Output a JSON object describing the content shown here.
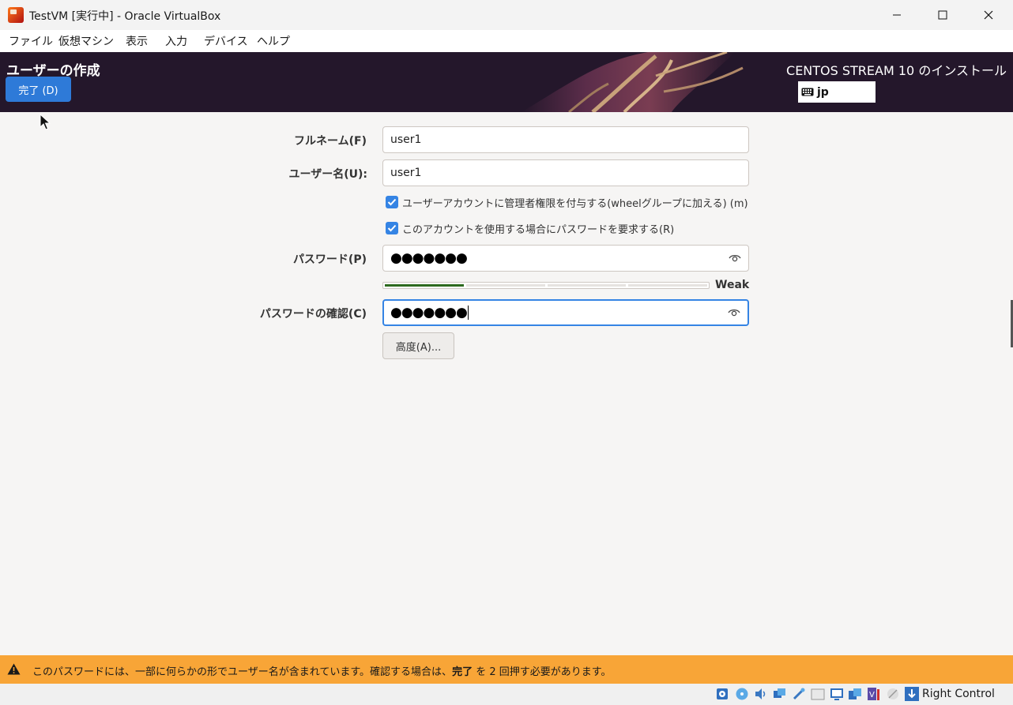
{
  "window": {
    "title": "TestVM [実行中] - Oracle VirtualBox",
    "icon": "virtualbox-icon"
  },
  "menu": {
    "items": [
      "ファイル",
      "仮想マシン",
      "表示",
      "入力",
      "デバイス",
      "ヘルプ"
    ]
  },
  "header": {
    "title": "ユーザーの作成",
    "done_label": "完了 (D)",
    "install_title": "CENTOS STREAM 10 のインストール",
    "keyboard_layout": "jp"
  },
  "form": {
    "fullname_label": "フルネーム(F)",
    "fullname_value": "user1",
    "username_label": "ユーザー名(U):",
    "username_value": "user1",
    "admin_checkbox_label": "ユーザーアカウントに管理者権限を付与する(wheelグループに加える) (m)",
    "admin_checked": true,
    "require_password_label": "このアカウントを使用する場合にパスワードを要求する(R)",
    "require_password_checked": true,
    "password_label": "パスワード(P)",
    "password_value": "●●●●●●●",
    "strength_level": 0.25,
    "strength_text": "Weak",
    "confirm_label": "パスワードの確認(C)",
    "confirm_value": "●●●●●●●",
    "advanced_label": "高度(A)..."
  },
  "warning": {
    "text_before": "このパスワードには、一部に何らかの形でユーザー名が含まれています。確認する場合は、",
    "text_bold": "完了",
    "text_after": " を 2 回押す必要があります。"
  },
  "statusbar": {
    "host_key": "Right Control"
  },
  "colors": {
    "accent": "#3584e4",
    "done_button": "#2e7ad8",
    "header_bg": "#24172b",
    "warning_bg": "#f8a537",
    "strength_fill": "#2d6a1f"
  }
}
